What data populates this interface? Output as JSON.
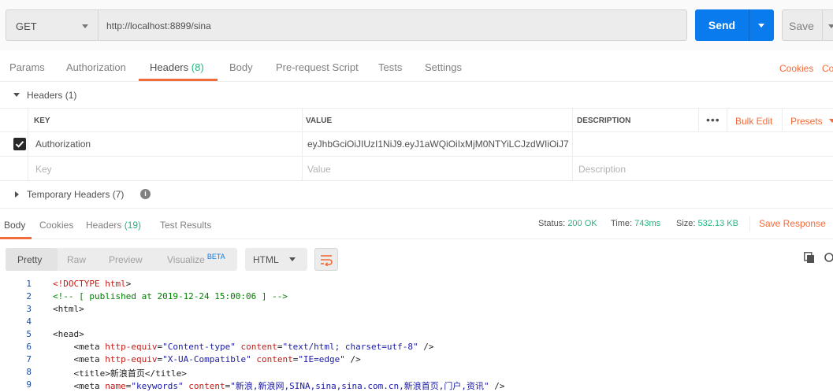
{
  "request": {
    "method": "GET",
    "url": "http://localhost:8899/sina",
    "send_label": "Send",
    "save_label": "Save"
  },
  "request_tabs": {
    "params": "Params",
    "authorization": "Authorization",
    "headers": "Headers",
    "headers_count": "(8)",
    "body": "Body",
    "prerequest": "Pre-request Script",
    "tests": "Tests",
    "settings": "Settings",
    "cookies": "Cookies",
    "code": "Co"
  },
  "headers_section": {
    "title": "Headers (1)",
    "columns": {
      "key": "KEY",
      "value": "VALUE",
      "description": "DESCRIPTION"
    },
    "more": "•••",
    "bulk_edit": "Bulk Edit",
    "presets": "Presets",
    "rows": [
      {
        "checked": true,
        "key": "Authorization",
        "value": "eyJhbGciOiJIUzI1NiJ9.eyJ1aWQiOiIxMjM0NTYiLCJzdWIiOiJ7..."
      }
    ],
    "placeholders": {
      "key": "Key",
      "value": "Value",
      "description": "Description"
    },
    "temporary_title": "Temporary Headers (7)",
    "info": "i"
  },
  "response": {
    "tabs": {
      "body": "Body",
      "cookies": "Cookies",
      "headers": "Headers",
      "headers_count": "(19)",
      "test_results": "Test Results"
    },
    "status_label": "Status:",
    "status_value": "200 OK",
    "time_label": "Time:",
    "time_value": "743ms",
    "size_label": "Size:",
    "size_value": "532.13 KB",
    "save_response": "Save Response"
  },
  "body_toolbar": {
    "views": {
      "pretty": "Pretty",
      "raw": "Raw",
      "preview": "Preview",
      "visualize": "Visualize",
      "beta": "BETA"
    },
    "format": "HTML"
  },
  "code_lines": [
    {
      "n": "1",
      "indent": "",
      "parts": [
        [
          "doctype",
          "<!DOCTYPE "
        ],
        [
          "attr",
          "html"
        ],
        [
          "tag",
          ">"
        ]
      ]
    },
    {
      "n": "2",
      "indent": "",
      "parts": [
        [
          "comment",
          "<!-- [ published at 2019-12-24 15:00:06 ] -->"
        ]
      ]
    },
    {
      "n": "3",
      "indent": "",
      "parts": [
        [
          "tag",
          "<html>"
        ]
      ]
    },
    {
      "n": "4",
      "indent": "",
      "parts": []
    },
    {
      "n": "5",
      "indent": "",
      "parts": [
        [
          "tag",
          "<head>"
        ]
      ]
    },
    {
      "n": "6",
      "indent": "    ",
      "parts": [
        [
          "tag",
          "<meta "
        ],
        [
          "attr",
          "http-equiv"
        ],
        [
          "tag",
          "="
        ],
        [
          "val",
          "\"Content-type\""
        ],
        [
          "tag",
          " "
        ],
        [
          "attr",
          "content"
        ],
        [
          "tag",
          "="
        ],
        [
          "val",
          "\"text/html; charset=utf-8\""
        ],
        [
          "tag",
          " />"
        ]
      ]
    },
    {
      "n": "7",
      "indent": "    ",
      "parts": [
        [
          "tag",
          "<meta "
        ],
        [
          "attr",
          "http-equiv"
        ],
        [
          "tag",
          "="
        ],
        [
          "val",
          "\"X-UA-Compatible\""
        ],
        [
          "tag",
          " "
        ],
        [
          "attr",
          "content"
        ],
        [
          "tag",
          "="
        ],
        [
          "val",
          "\"IE=edge\""
        ],
        [
          "tag",
          " />"
        ]
      ]
    },
    {
      "n": "8",
      "indent": "    ",
      "parts": [
        [
          "tag",
          "<title>"
        ],
        [
          "text",
          "新浪首页"
        ],
        [
          "tag",
          "</title>"
        ]
      ]
    },
    {
      "n": "9",
      "indent": "    ",
      "parts": [
        [
          "tag",
          "<meta "
        ],
        [
          "attr",
          "name"
        ],
        [
          "tag",
          "="
        ],
        [
          "val",
          "\"keywords\""
        ],
        [
          "tag",
          " "
        ],
        [
          "attr",
          "content"
        ],
        [
          "tag",
          "="
        ],
        [
          "val",
          "\"新浪,新浪网,SINA,sina,sina.com.cn,新浪首页,门户,资讯\""
        ],
        [
          "tag",
          " />"
        ]
      ]
    }
  ]
}
